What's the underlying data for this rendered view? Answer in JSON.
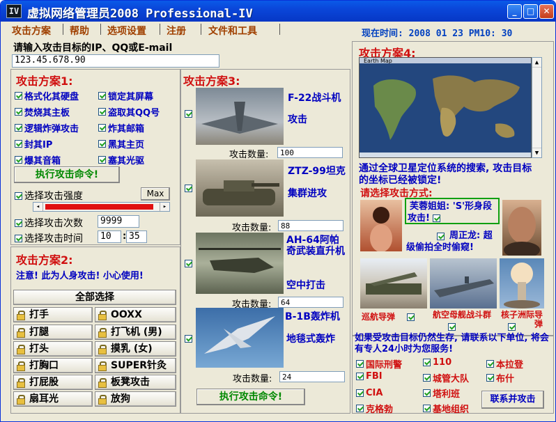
{
  "window": {
    "title": "虚拟网络管理员2008 Professional-IV",
    "icon": "app-logo-icon"
  },
  "menu": [
    "攻击方案",
    "帮助",
    "选项设置",
    "注册",
    "文件和工具"
  ],
  "clock": "现在时间: 2008 01 23   PM10: 30",
  "target": {
    "label": "请输入攻击目标的IP、QQ或E-mail",
    "value": "123.45.678.90"
  },
  "plan1": {
    "title": "攻击方案1:",
    "options": [
      "格式化其硬盘",
      "锁定其屏幕",
      "焚烧其主板",
      "盗取其QQ号",
      "逻辑炸弹攻击",
      "炸其邮箱",
      "封其IP",
      "黑其主页",
      "爆其音箱",
      "塞其光驱"
    ],
    "exec_label": "执行攻击命令!",
    "strength_label": "选择攻击强度",
    "max_label": "Max",
    "strength_value": 0.95,
    "count_label": "选择攻击次数",
    "count_value": "9999",
    "time_label": "选择攻击时间",
    "time_hour": "10",
    "time_min": "35"
  },
  "plan2": {
    "title": "攻击方案2:",
    "warning": "注意! 此为人身攻击! 小心使用!",
    "select_all": "全部选择",
    "actions": [
      "打手",
      "OOXX",
      "打腿",
      "打飞机 (男)",
      "打头",
      "摸乳 (女)",
      "打胸口",
      "SUPER针灸",
      "打屁股",
      "板凳攻击",
      "扇耳光",
      "放狗"
    ]
  },
  "plan3": {
    "title": "攻击方案3:",
    "weapons": [
      {
        "name": "F-22战斗机",
        "action": "攻击",
        "count_label": "攻击数量:",
        "count": "100"
      },
      {
        "name": "ZTZ-99坦克",
        "action": "集群进攻",
        "count_label": "攻击数量:",
        "count": "88"
      },
      {
        "name": "AH-64阿帕奇武装直升机",
        "action": "空中打击",
        "count_label": "攻击数量:",
        "count": "64"
      },
      {
        "name": "B-1B轰炸机",
        "action": "地毯式轰炸",
        "count_label": "攻击数量:",
        "count": "24"
      }
    ],
    "exec_label": "执行攻击命令!"
  },
  "plan4": {
    "title": "攻击方案4:",
    "map_caption": "Earth Map",
    "gps_text": "通过全球卫星定位系统的搜索, 攻击目标的坐标已经被锁定!",
    "choose_label": "请选择攻击方式:",
    "person1": "芙蓉姐姐: 'S'形身段攻击!",
    "person2": "周正龙: 超级偷拍全时偷窥!",
    "weapons": [
      "巡航导弹",
      "航空母舰战斗群",
      "核子洲际导弹"
    ]
  },
  "help": {
    "text": "如果受攻击目标仍然生存, 请联系以下单位, 将会有专人24小时为您服务!",
    "orgs": [
      "国际刑警",
      "110",
      "本拉登",
      "FBI",
      "城管大队",
      "布什",
      "CIA",
      "塔利班",
      "克格勃",
      "基地组织"
    ],
    "contact_label": "联系并攻击"
  },
  "colors": {
    "accent_red": "#d01010",
    "accent_blue": "#0000c0",
    "title_blue": "#0a46d9",
    "progress": "#e01010"
  }
}
